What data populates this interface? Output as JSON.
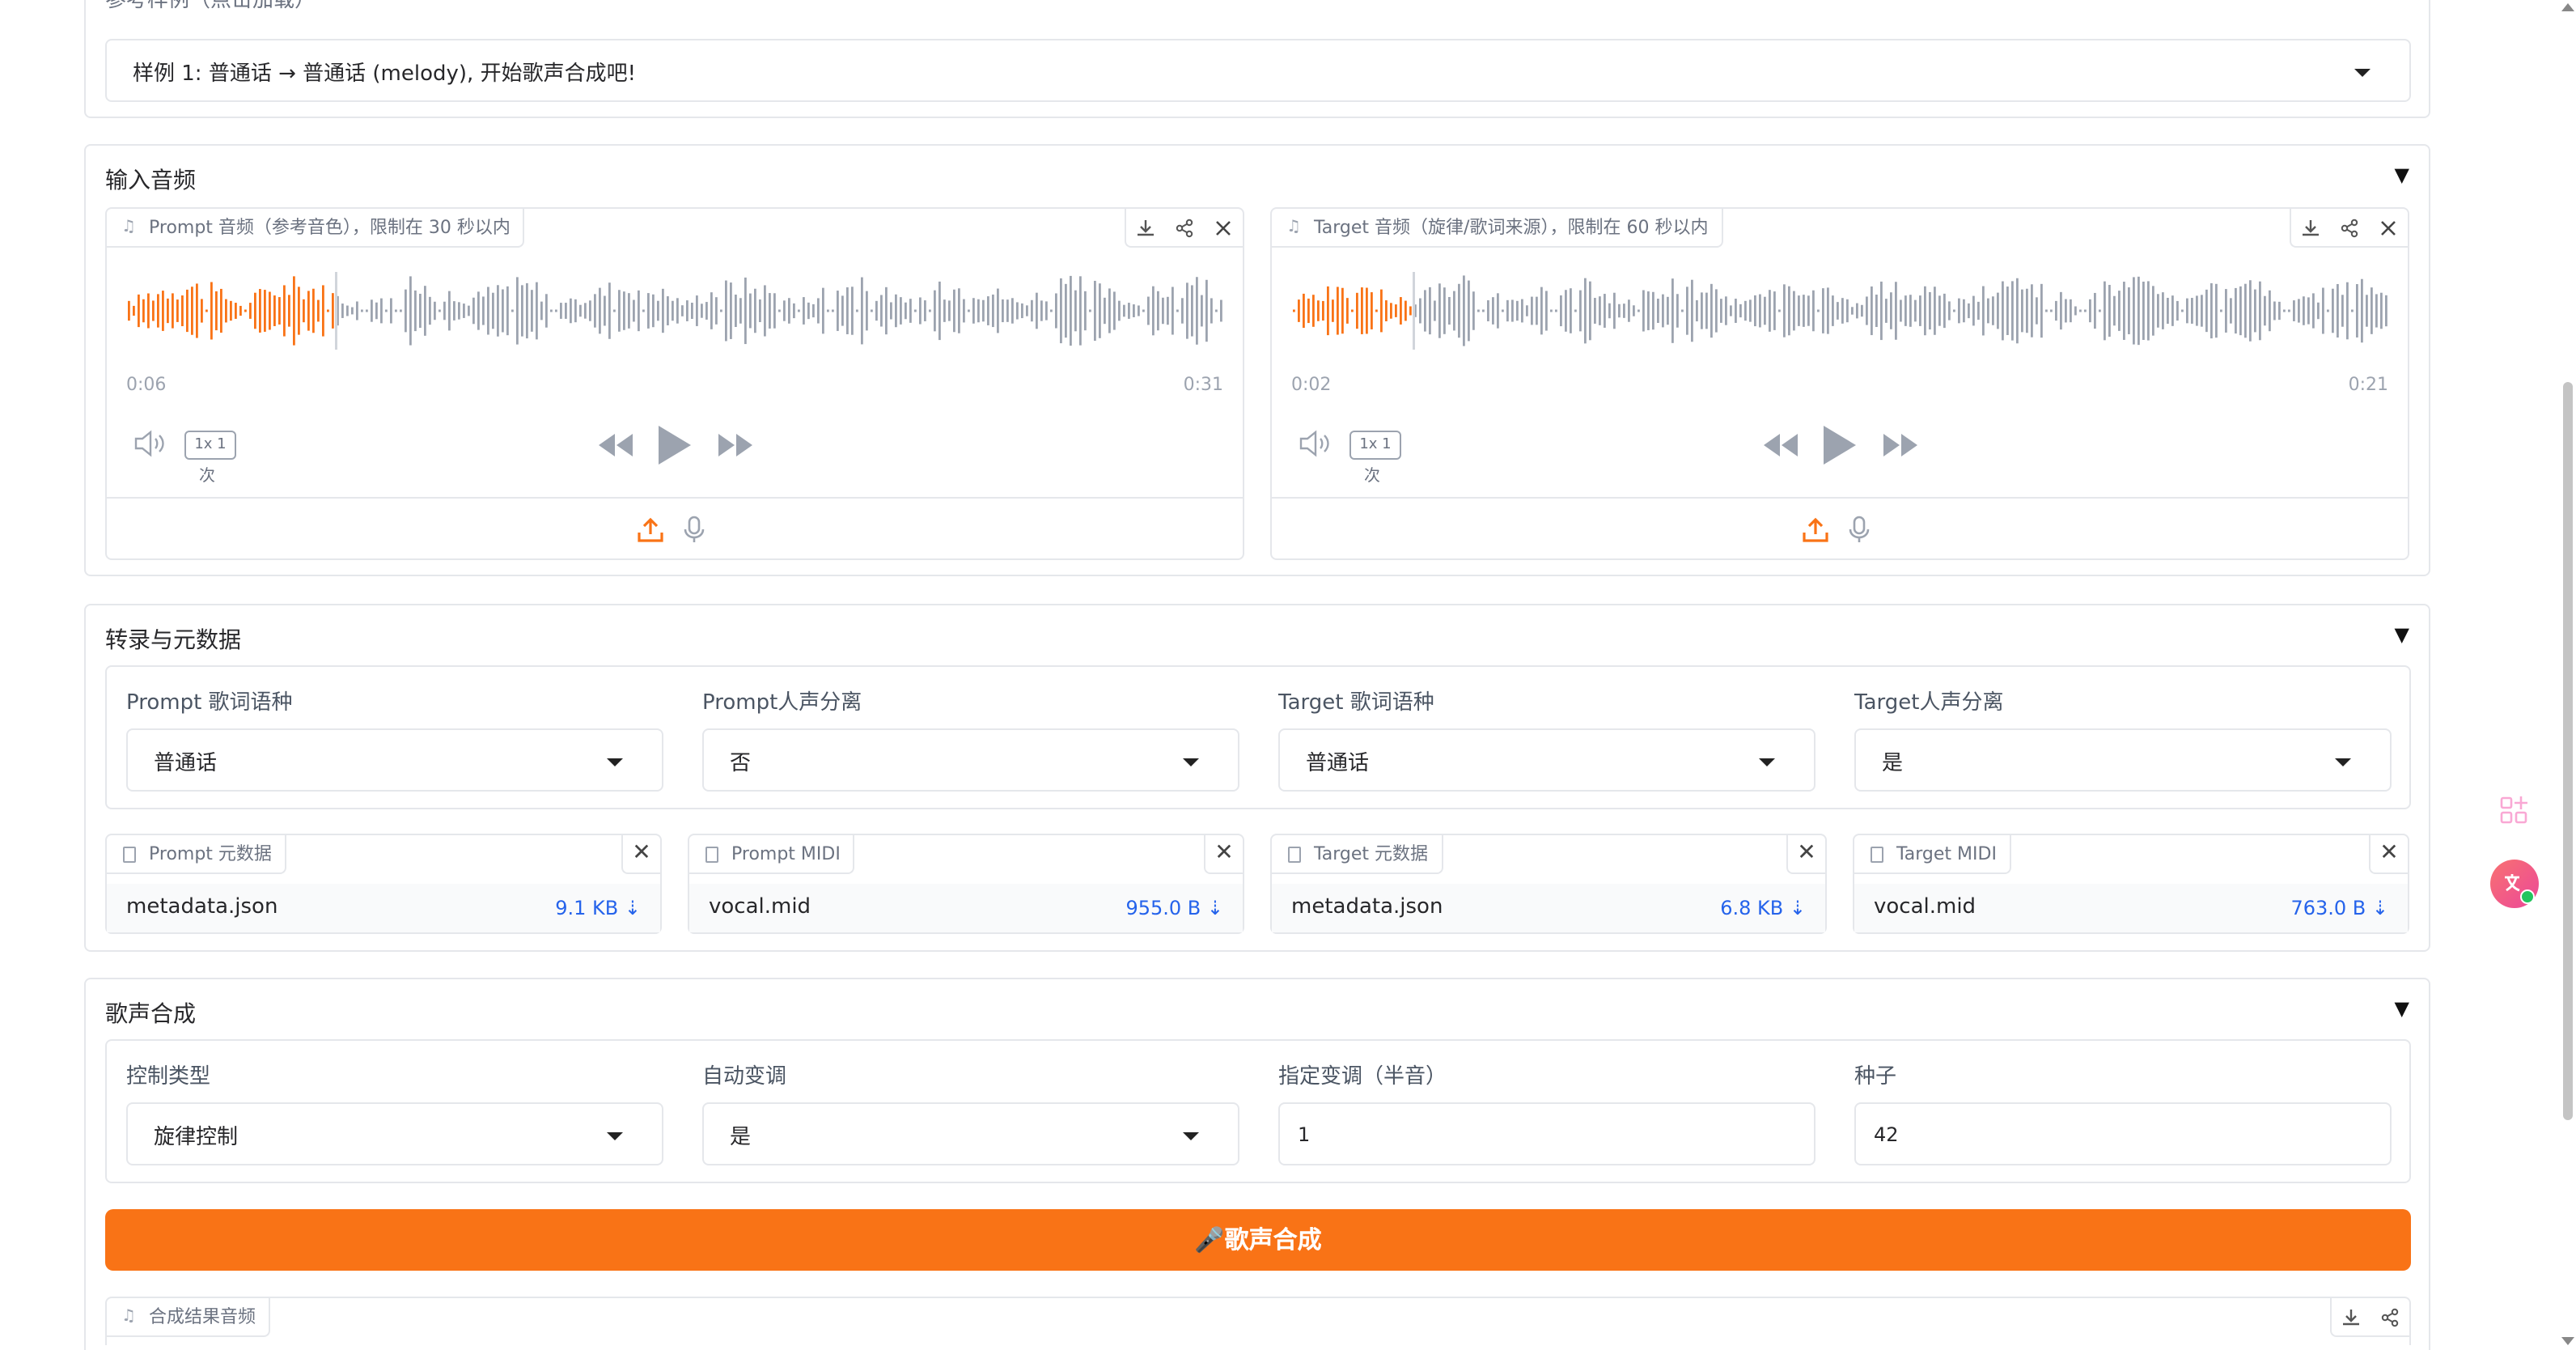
{
  "examples": {
    "label": "参考样例（点击加载）",
    "selected": "样例 1: 普通话 → 普通话 (melody), 开始歌声合成吧!"
  },
  "input_audio": {
    "title": "输入音频",
    "prompt": {
      "label": "Prompt 音频（参考音色），限制在 30 秒以内",
      "current_time": "0:06",
      "duration": "0:31",
      "rate": "1x 1",
      "rate_sub": "次",
      "progress": 0.19
    },
    "target": {
      "label": "Target 音频（旋律/歌词来源），限制在 60 秒以内",
      "current_time": "0:02",
      "duration": "0:21",
      "rate": "1x 1",
      "rate_sub": "次",
      "progress": 0.11
    }
  },
  "transcription": {
    "title": "转录与元数据",
    "fields": [
      {
        "label": "Prompt 歌词语种",
        "value": "普通话"
      },
      {
        "label": "Prompt人声分离",
        "value": "否"
      },
      {
        "label": "Target 歌词语种",
        "value": "普通话"
      },
      {
        "label": "Target人声分离",
        "value": "是"
      }
    ],
    "files": [
      {
        "label": "Prompt 元数据",
        "name": "metadata.json",
        "size": "9.1 KB ⇣"
      },
      {
        "label": "Prompt MIDI",
        "name": "vocal.mid",
        "size": "955.0 B ⇣"
      },
      {
        "label": "Target 元数据",
        "name": "metadata.json",
        "size": "6.8 KB ⇣"
      },
      {
        "label": "Target MIDI",
        "name": "vocal.mid",
        "size": "763.0 B ⇣"
      }
    ]
  },
  "synthesis": {
    "title": "歌声合成",
    "control_type": {
      "label": "控制类型",
      "value": "旋律控制"
    },
    "auto_pitch": {
      "label": "自动变调",
      "value": "是"
    },
    "pitch_shift": {
      "label": "指定变调（半音）",
      "value": "1"
    },
    "seed": {
      "label": "种子",
      "value": "42"
    },
    "button": "🎤歌声合成",
    "result_label": "合成结果音频"
  },
  "colors": {
    "accent": "#f97316",
    "wave_played": "#f97316",
    "wave_unplayed": "#9ca3af",
    "link": "#2563eb"
  },
  "toggle_glyph": "▼"
}
